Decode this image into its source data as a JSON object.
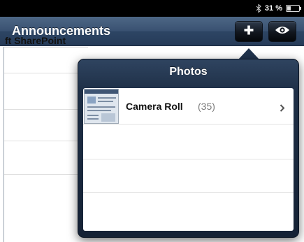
{
  "status_bar": {
    "battery_text": "31 %",
    "battery_level": 0.31,
    "icons": [
      "bluetooth-icon",
      "battery-icon"
    ]
  },
  "nav": {
    "title": "Announcements",
    "buttons": [
      {
        "name": "add-button",
        "icon": "plus-icon"
      },
      {
        "name": "view-button",
        "icon": "eye-icon"
      }
    ]
  },
  "list": {
    "visible_text": "ft SharePoint"
  },
  "popover": {
    "title": "Photos",
    "albums": [
      {
        "name": "Camera Roll",
        "count": "(35)",
        "icon": "chevron-right-icon"
      }
    ]
  },
  "colors": {
    "nav_bar": "#3a5272",
    "popover": "#1e2f46",
    "status_bar": "#000000"
  }
}
